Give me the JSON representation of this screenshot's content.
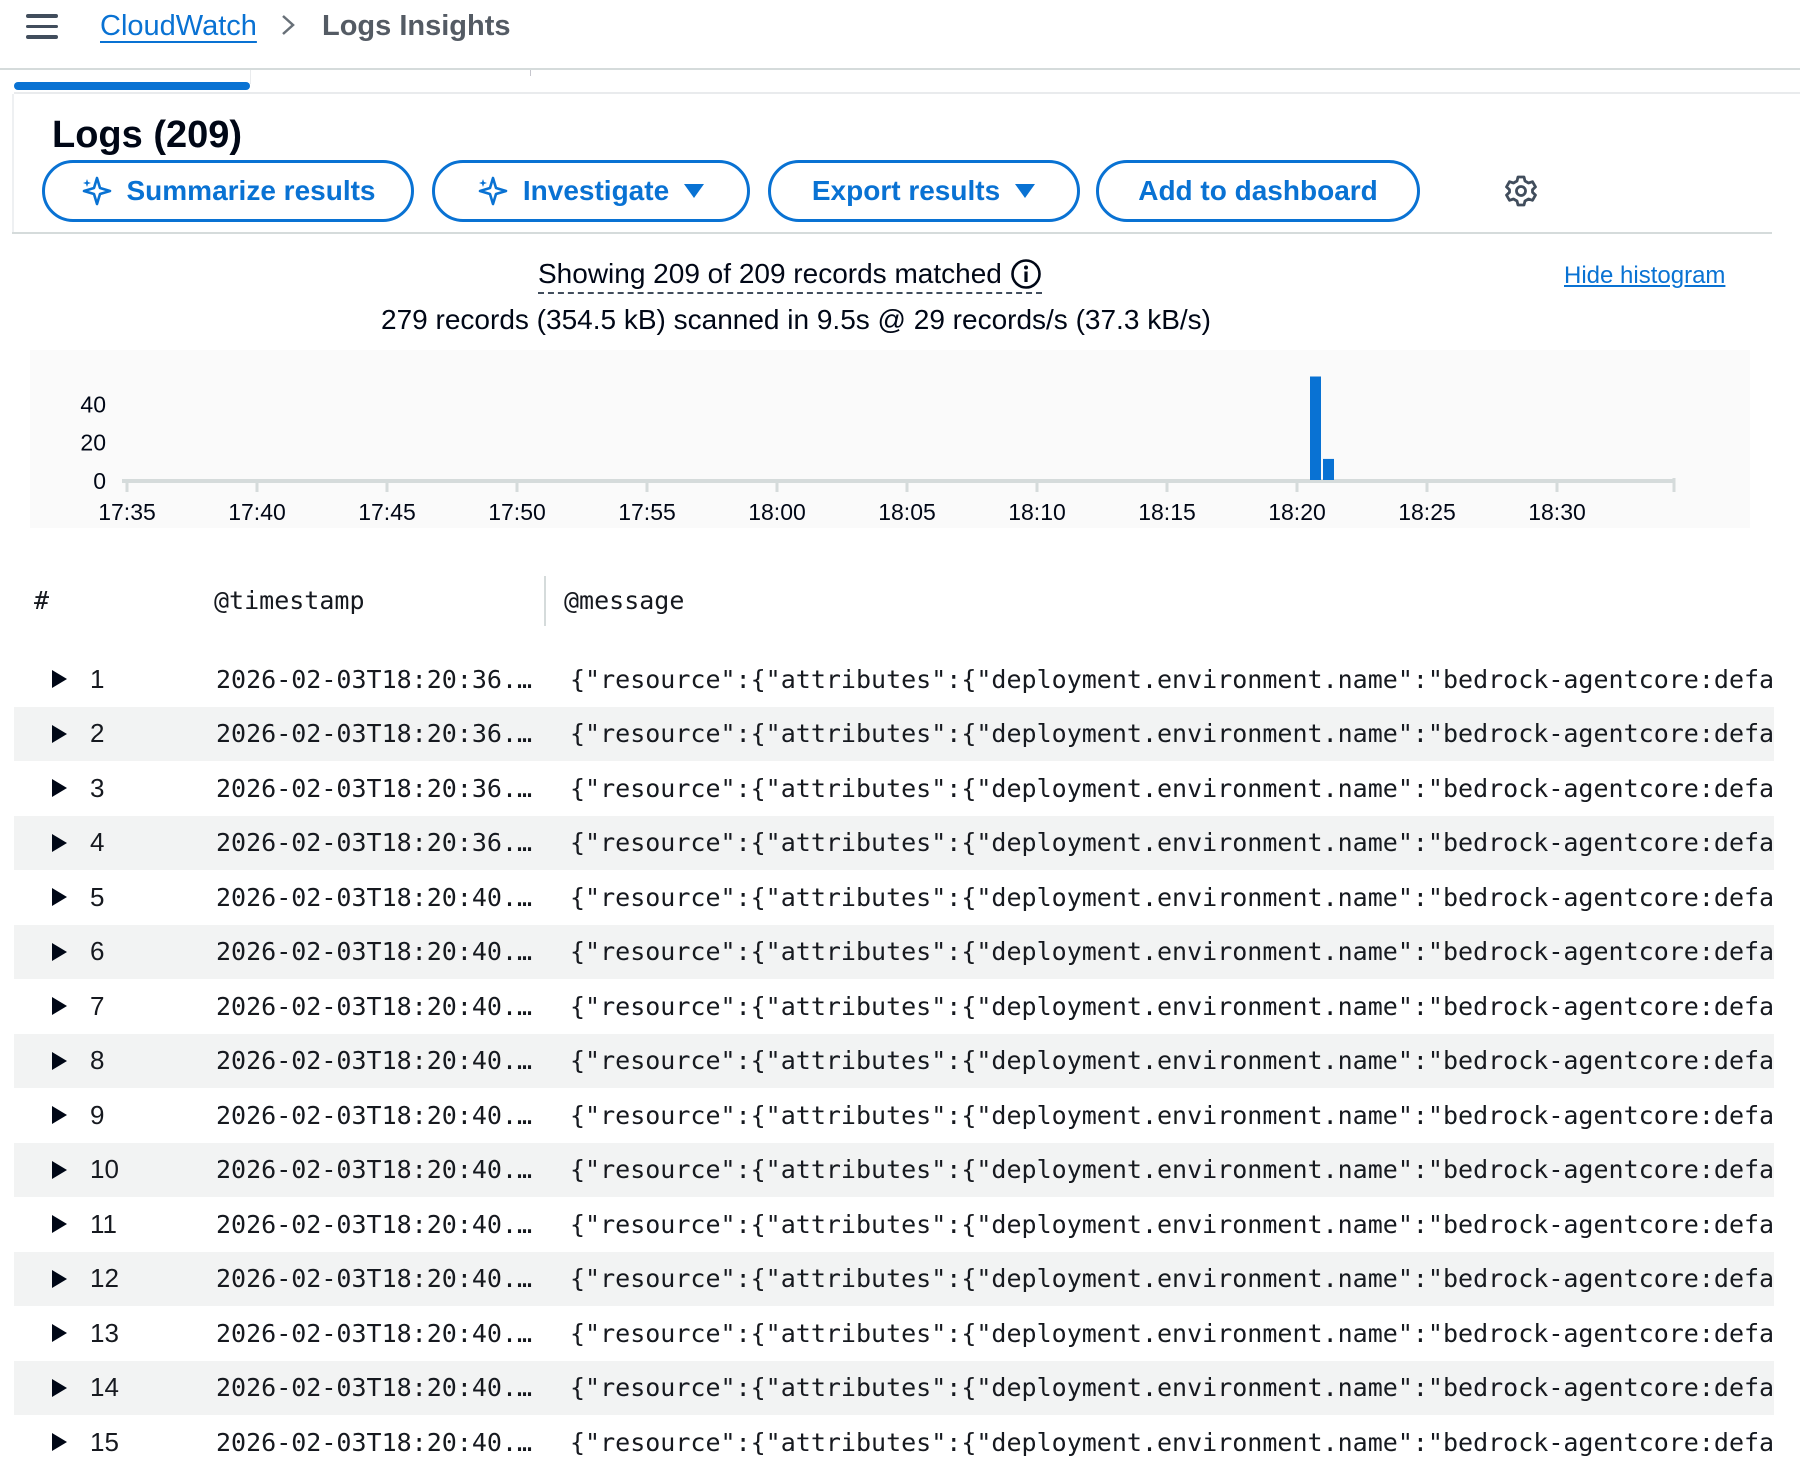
{
  "breadcrumb": {
    "root": "CloudWatch",
    "current": "Logs Insights"
  },
  "panel": {
    "title": "Logs (209)"
  },
  "actions": {
    "summarize": "Summarize results",
    "investigate": "Investigate",
    "export": "Export results",
    "add_dashboard": "Add to dashboard"
  },
  "summary": {
    "matched": "Showing 209 of 209 records matched",
    "scanned": "279 records (354.5 kB) scanned in 9.5s @ 29 records/s (37.3 kB/s)",
    "hide_histogram": "Hide histogram"
  },
  "colors": {
    "accent": "#0972d3",
    "bar": "#0972d3"
  },
  "chart_data": {
    "type": "bar",
    "title": "",
    "xlabel": "",
    "ylabel": "",
    "y_ticks": [
      0,
      20,
      40
    ],
    "x_ticks": [
      "17:35",
      "17:40",
      "17:45",
      "17:50",
      "17:55",
      "18:00",
      "18:05",
      "18:10",
      "18:15",
      "18:20",
      "18:25",
      "18:30"
    ],
    "series": [
      {
        "x": [
          "18:20:30",
          "18:21:00"
        ],
        "values": [
          54,
          11
        ]
      }
    ]
  },
  "table": {
    "headers": {
      "num": "#",
      "timestamp": "@timestamp",
      "message": "@message"
    },
    "rows": [
      {
        "n": "1",
        "ts": "2026-02-03T18:20:36.0…",
        "msg": "{\"resource\":{\"attributes\":{\"deployment.environment.name\":\"bedrock-agentcore:default'"
      },
      {
        "n": "2",
        "ts": "2026-02-03T18:20:36.1…",
        "msg": "{\"resource\":{\"attributes\":{\"deployment.environment.name\":\"bedrock-agentcore:default'"
      },
      {
        "n": "3",
        "ts": "2026-02-03T18:20:36.1…",
        "msg": "{\"resource\":{\"attributes\":{\"deployment.environment.name\":\"bedrock-agentcore:default'"
      },
      {
        "n": "4",
        "ts": "2026-02-03T18:20:36.1…",
        "msg": "{\"resource\":{\"attributes\":{\"deployment.environment.name\":\"bedrock-agentcore:default'"
      },
      {
        "n": "5",
        "ts": "2026-02-03T18:20:40.1…",
        "msg": "{\"resource\":{\"attributes\":{\"deployment.environment.name\":\"bedrock-agentcore:default'"
      },
      {
        "n": "6",
        "ts": "2026-02-03T18:20:40.1…",
        "msg": "{\"resource\":{\"attributes\":{\"deployment.environment.name\":\"bedrock-agentcore:default'"
      },
      {
        "n": "7",
        "ts": "2026-02-03T18:20:40.1…",
        "msg": "{\"resource\":{\"attributes\":{\"deployment.environment.name\":\"bedrock-agentcore:default'"
      },
      {
        "n": "8",
        "ts": "2026-02-03T18:20:40.1…",
        "msg": "{\"resource\":{\"attributes\":{\"deployment.environment.name\":\"bedrock-agentcore:default'"
      },
      {
        "n": "9",
        "ts": "2026-02-03T18:20:40.1…",
        "msg": "{\"resource\":{\"attributes\":{\"deployment.environment.name\":\"bedrock-agentcore:default'"
      },
      {
        "n": "10",
        "ts": "2026-02-03T18:20:40.1…",
        "msg": "{\"resource\":{\"attributes\":{\"deployment.environment.name\":\"bedrock-agentcore:default'"
      },
      {
        "n": "11",
        "ts": "2026-02-03T18:20:40.1…",
        "msg": "{\"resource\":{\"attributes\":{\"deployment.environment.name\":\"bedrock-agentcore:default'"
      },
      {
        "n": "12",
        "ts": "2026-02-03T18:20:40.1…",
        "msg": "{\"resource\":{\"attributes\":{\"deployment.environment.name\":\"bedrock-agentcore:default'"
      },
      {
        "n": "13",
        "ts": "2026-02-03T18:20:40.1…",
        "msg": "{\"resource\":{\"attributes\":{\"deployment.environment.name\":\"bedrock-agentcore:default'"
      },
      {
        "n": "14",
        "ts": "2026-02-03T18:20:40.1…",
        "msg": "{\"resource\":{\"attributes\":{\"deployment.environment.name\":\"bedrock-agentcore:default'"
      },
      {
        "n": "15",
        "ts": "2026-02-03T18:20:40.1…",
        "msg": "{\"resource\":{\"attributes\":{\"deployment.environment.name\":\"bedrock-agentcore:default'"
      }
    ]
  }
}
